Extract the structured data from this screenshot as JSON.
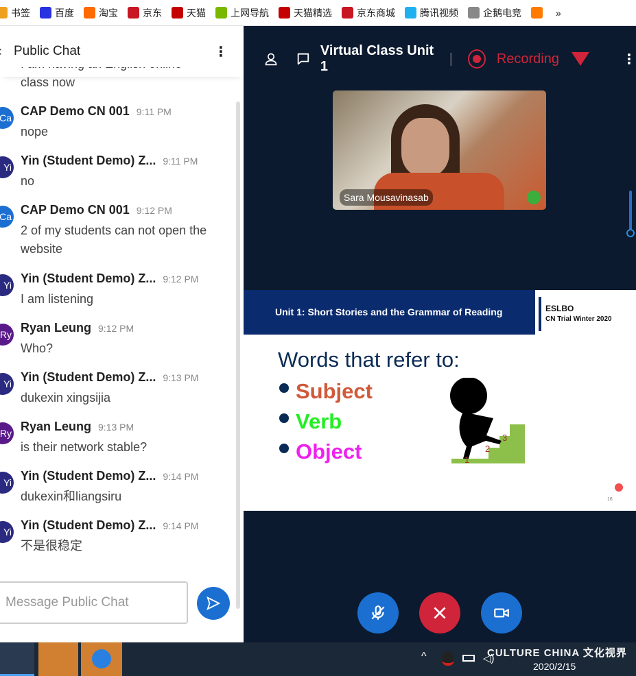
{
  "bookmarks": [
    {
      "label": "书签",
      "color": "#f0a020"
    },
    {
      "label": "百度",
      "color": "#2932e1"
    },
    {
      "label": "淘宝",
      "color": "#ff6a00"
    },
    {
      "label": "京东",
      "color": "#c81623"
    },
    {
      "label": "天猫",
      "color": "#c40000"
    },
    {
      "label": "上网导航",
      "color": "#7ab800"
    },
    {
      "label": "天猫精选",
      "color": "#c40000"
    },
    {
      "label": "京东商城",
      "color": "#c81623"
    },
    {
      "label": "腾讯视频",
      "color": "#20b0f0"
    },
    {
      "label": "企鹅电竞",
      "color": "#888888"
    },
    {
      "label": "",
      "color": "#ff7a00"
    }
  ],
  "bookmarks_more": "»",
  "chat": {
    "title": "Public Chat",
    "placeholder": "Message Public Chat",
    "messages": [
      {
        "name": "",
        "time": "",
        "text": "I am having an English online class now",
        "av": "",
        "color": ""
      },
      {
        "name": "CAP Demo CN 001",
        "time": "9:11 PM",
        "text": "nope",
        "av": "Ca",
        "color": "#1b6fd1"
      },
      {
        "name": "Yin (Student Demo) Z...",
        "time": "9:11 PM",
        "text": "no",
        "av": "Yi",
        "color": "#2a2a80"
      },
      {
        "name": "CAP Demo CN 001",
        "time": "9:12 PM",
        "text": "2 of my students can not open the website",
        "av": "Ca",
        "color": "#1b6fd1"
      },
      {
        "name": "Yin (Student Demo) Z...",
        "time": "9:12 PM",
        "text": "I am listening",
        "av": "Yi",
        "color": "#2a2a80"
      },
      {
        "name": "Ryan Leung",
        "time": "9:12 PM",
        "text": "Who?",
        "av": "Ry",
        "color": "#5a1a8a"
      },
      {
        "name": "Yin (Student Demo) Z...",
        "time": "9:13 PM",
        "text": "dukexin xingsijia",
        "av": "Yi",
        "color": "#2a2a80"
      },
      {
        "name": "Ryan Leung",
        "time": "9:13 PM",
        "text": "is their network stable?",
        "av": "Ry",
        "color": "#5a1a8a"
      },
      {
        "name": "Yin (Student Demo) Z...",
        "time": "9:14 PM",
        "text": "dukexin和liangsiru",
        "av": "Yi",
        "color": "#2a2a80"
      },
      {
        "name": "Yin (Student Demo) Z...",
        "time": "9:14 PM",
        "text": "不是很稳定",
        "av": "Yi",
        "color": "#2a2a80"
      }
    ]
  },
  "meeting": {
    "title": "Virtual Class Unit 1",
    "recording": "Recording",
    "presenter": "Sara Mousavinasab",
    "accent": "#d0243a"
  },
  "slide": {
    "header": "Unit 1: Short Stories and the Grammar of Reading",
    "brand": "ESLBO",
    "brand_sub": "CN Trial Winter 2020",
    "heading": "Words that refer to:",
    "bullets": [
      {
        "text": "Subject",
        "color": "#d05a3a"
      },
      {
        "text": "Verb",
        "color": "#22ee22"
      },
      {
        "text": "Object",
        "color": "#ee22ee"
      }
    ],
    "page": "16"
  },
  "taskbar": {
    "date": "2020/2/15",
    "watermark": "CULTURE CHINA 文化视界"
  }
}
